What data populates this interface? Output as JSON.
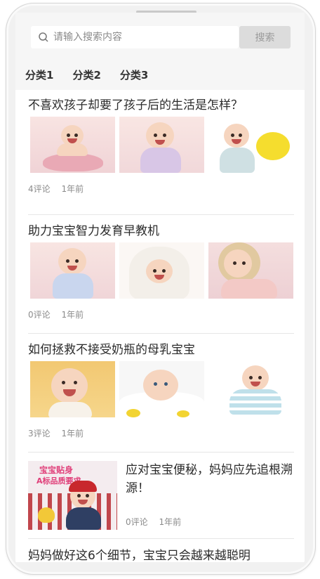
{
  "search": {
    "placeholder": "请输入搜索内容",
    "button_label": "搜索"
  },
  "tabs": [
    {
      "label": "分类1"
    },
    {
      "label": "分类2"
    },
    {
      "label": "分类3"
    }
  ],
  "articles": [
    {
      "title": "不喜欢孩子却要了孩子后的生活是怎样？",
      "comments": "4评论",
      "time": "1年前"
    },
    {
      "title": "助力宝宝智力发育早教机",
      "comments": "0评论",
      "time": "1年前"
    },
    {
      "title": "如何拯救不接受奶瓶的母乳宝宝",
      "comments": "3评论",
      "time": "1年前"
    },
    {
      "title": "应对宝宝便秘，妈妈应先追根溯源！",
      "comments": "0评论",
      "time": "1年前",
      "image_caption_line1": "宝宝贴身",
      "image_caption_line2": "A标品质要求"
    },
    {
      "title": "妈妈做好这6个细节，宝宝只会越来越聪明"
    }
  ],
  "colors": {
    "header_bg": "#f6f6f6",
    "button_bg": "#dcdcdc",
    "text": "#2b2b2b",
    "meta": "#8b8b8b"
  }
}
